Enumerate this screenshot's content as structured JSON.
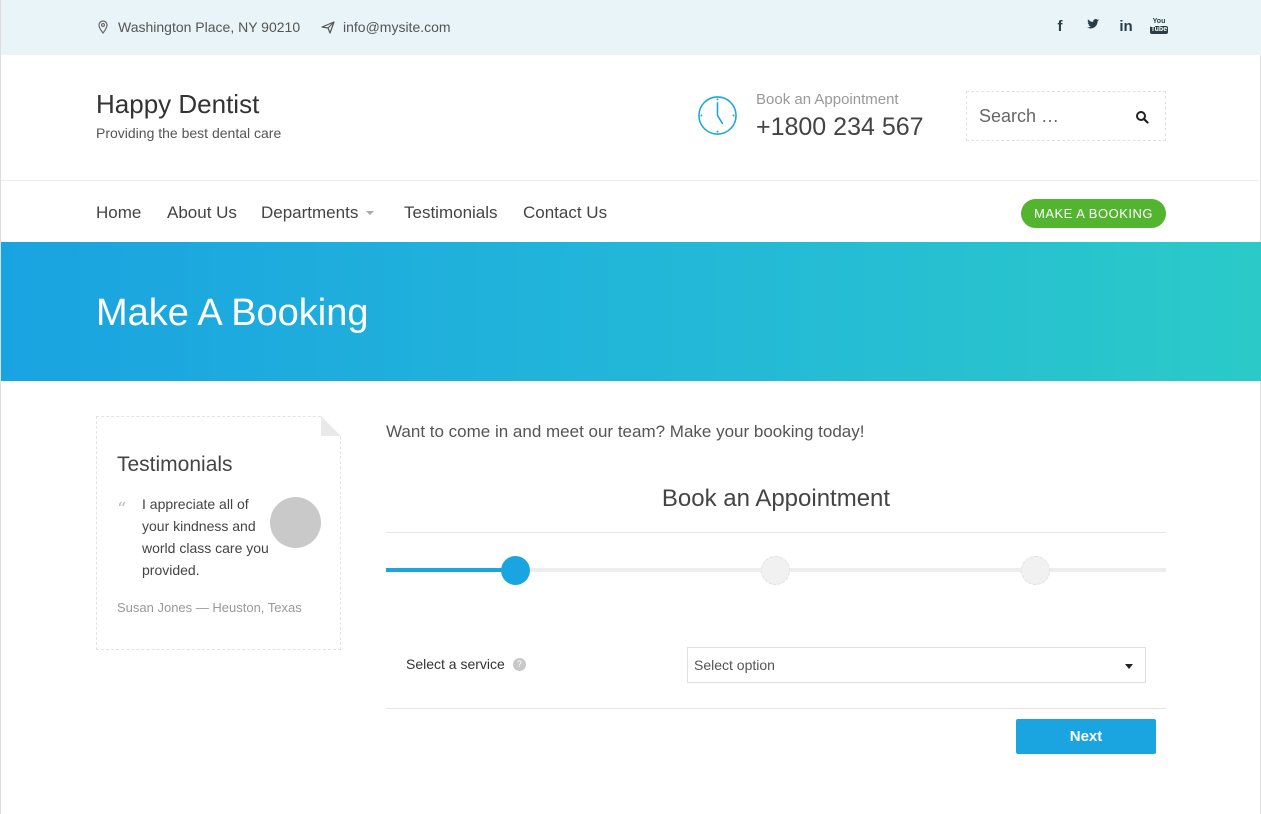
{
  "topbar": {
    "address": "Washington Place, NY 90210",
    "email": "info@mysite.com",
    "social": [
      {
        "icon": "facebook-icon",
        "glyph": "f"
      },
      {
        "icon": "twitter-icon",
        "glyph": "t"
      },
      {
        "icon": "linkedin-icon",
        "glyph": "in"
      },
      {
        "icon": "youtube-icon",
        "glyph": "You Tube"
      }
    ]
  },
  "header": {
    "brand_title": "Happy Dentist",
    "brand_sub": "Providing the best dental care",
    "appt_label": "Book an Appointment",
    "appt_phone": "+1800 234 567",
    "search_placeholder": "Search …"
  },
  "nav": {
    "items": [
      "Home",
      "About Us",
      "Departments",
      "Testimonials",
      "Contact Us"
    ],
    "cta": "MAKE A BOOKING"
  },
  "banner": {
    "title": "Make A Booking"
  },
  "sidebar": {
    "title": "Testimonials",
    "quote": "I appreciate all of your kindness and world class care you provided.",
    "author": "Susan Jones — Heuston, Texas"
  },
  "main": {
    "intro": "Want to come in and meet our team? Make your booking today!",
    "form_title": "Book an Appointment",
    "steps_total": 3,
    "current_step": 1,
    "service_label": "Select a service",
    "service_select": "Select option",
    "next_label": "Next"
  },
  "colors": {
    "accent": "#1ba5e0",
    "cta_green": "#53b42f",
    "topbar_bg": "#e8f4f8"
  }
}
